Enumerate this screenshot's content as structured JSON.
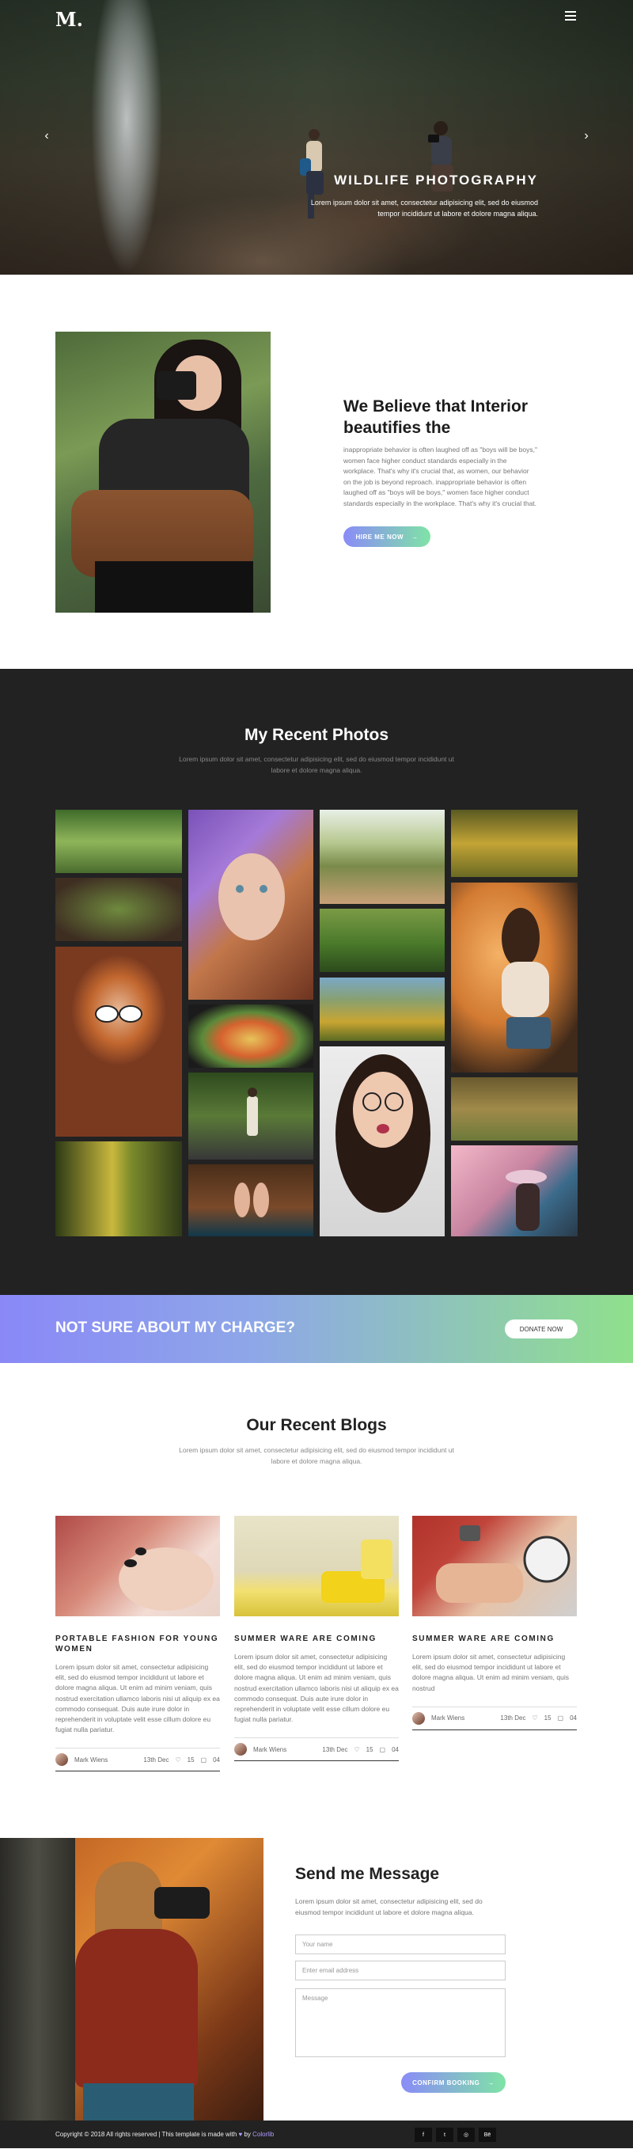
{
  "hero": {
    "logo": "M.",
    "title": "WILDLIFE PHOTOGRAPHY",
    "text": "Lorem ipsum dolor sit amet, consectetur adipisicing elit, sed do eiusmod tempor incididunt ut labore et dolore magna aliqua.",
    "prev_icon": "chevron-left-icon",
    "next_icon": "chevron-right-icon",
    "menu_icon": "hamburger-menu-icon"
  },
  "about": {
    "title": "We Believe that Interior beautifies the",
    "text": "inappropriate behavior is often laughed off as \"boys will be boys,\" women face higher conduct standards especially in the workplace. That's why it's crucial that, as women, our behavior on the job is beyond reproach. inappropriate behavior is often laughed off as \"boys will be boys,\" women face higher conduct standards especially in the workplace. That's why it's crucial that.",
    "button": "HIRE ME NOW",
    "button_arrow": "→"
  },
  "photos": {
    "title": "My Recent Photos",
    "subtitle": "Lorem ipsum dolor sit amet, consectetur adipisicing elit, sed do eiusmod tempor incididunt ut labore et dolore magna aliqua."
  },
  "cta": {
    "title": "NOT SURE ABOUT MY CHARGE?",
    "button": "DONATE NOW"
  },
  "blogs": {
    "title": "Our Recent Blogs",
    "subtitle": "Lorem ipsum dolor sit amet, consectetur adipisicing elit, sed do eiusmod tempor incididunt ut labore et dolore magna aliqua.",
    "items": [
      {
        "title": "PORTABLE FASHION FOR YOUNG WOMEN",
        "text": "Lorem ipsum dolor sit amet, consectetur adipisicing elit, sed do eiusmod tempor incididunt ut labore et dolore magna aliqua. Ut enim ad minim veniam, quis nostrud exercitation ullamco laboris nisi ut aliquip ex ea commodo consequat. Duis aute irure dolor in reprehenderit in voluptate velit esse cillum dolore eu fugiat nulla pariatur.",
        "author": "Mark Wiens",
        "date": "13th Dec",
        "likes": "15",
        "comments": "04"
      },
      {
        "title": "SUMMER WARE ARE COMING",
        "text": "Lorem ipsum dolor sit amet, consectetur adipisicing elit, sed do eiusmod tempor incididunt ut labore et dolore magna aliqua. Ut enim ad minim veniam, quis nostrud exercitation ullamco laboris nisi ut aliquip ex ea commodo consequat. Duis aute irure dolor in reprehenderit in voluptate velit esse cillum dolore eu fugiat nulla pariatur.",
        "author": "Mark Wiens",
        "date": "13th Dec",
        "likes": "15",
        "comments": "04"
      },
      {
        "title": "SUMMER WARE ARE COMING",
        "text": "Lorem ipsum dolor sit amet, consectetur adipisicing elit, sed do eiusmod tempor incididunt ut labore et dolore magna aliqua. Ut enim ad minim veniam, quis nostrud",
        "author": "Mark Wiens",
        "date": "13th Dec",
        "likes": "15",
        "comments": "04"
      }
    ]
  },
  "contact": {
    "title": "Send me Message",
    "text": "Lorem ipsum dolor sit amet, consectetur adipisicing elit, sed do eiusmod tempor incididunt ut labore et dolore magna aliqua.",
    "name_placeholder": "Your name",
    "email_placeholder": "Enter email address",
    "message_placeholder": "Message",
    "button": "CONFIRM BOOKING",
    "button_arrow": "→"
  },
  "footer": {
    "copyright_prefix": "Copyright © 2018 All rights reserved | This template is made with",
    "heart": "♥",
    "by": "by",
    "brand": "Colorlib",
    "socials": [
      "f",
      "t",
      "◎",
      "Bē"
    ]
  },
  "colors": {
    "accent_purple": "#8a8cf7",
    "accent_green": "#7fe3a6",
    "dark": "#222222"
  }
}
